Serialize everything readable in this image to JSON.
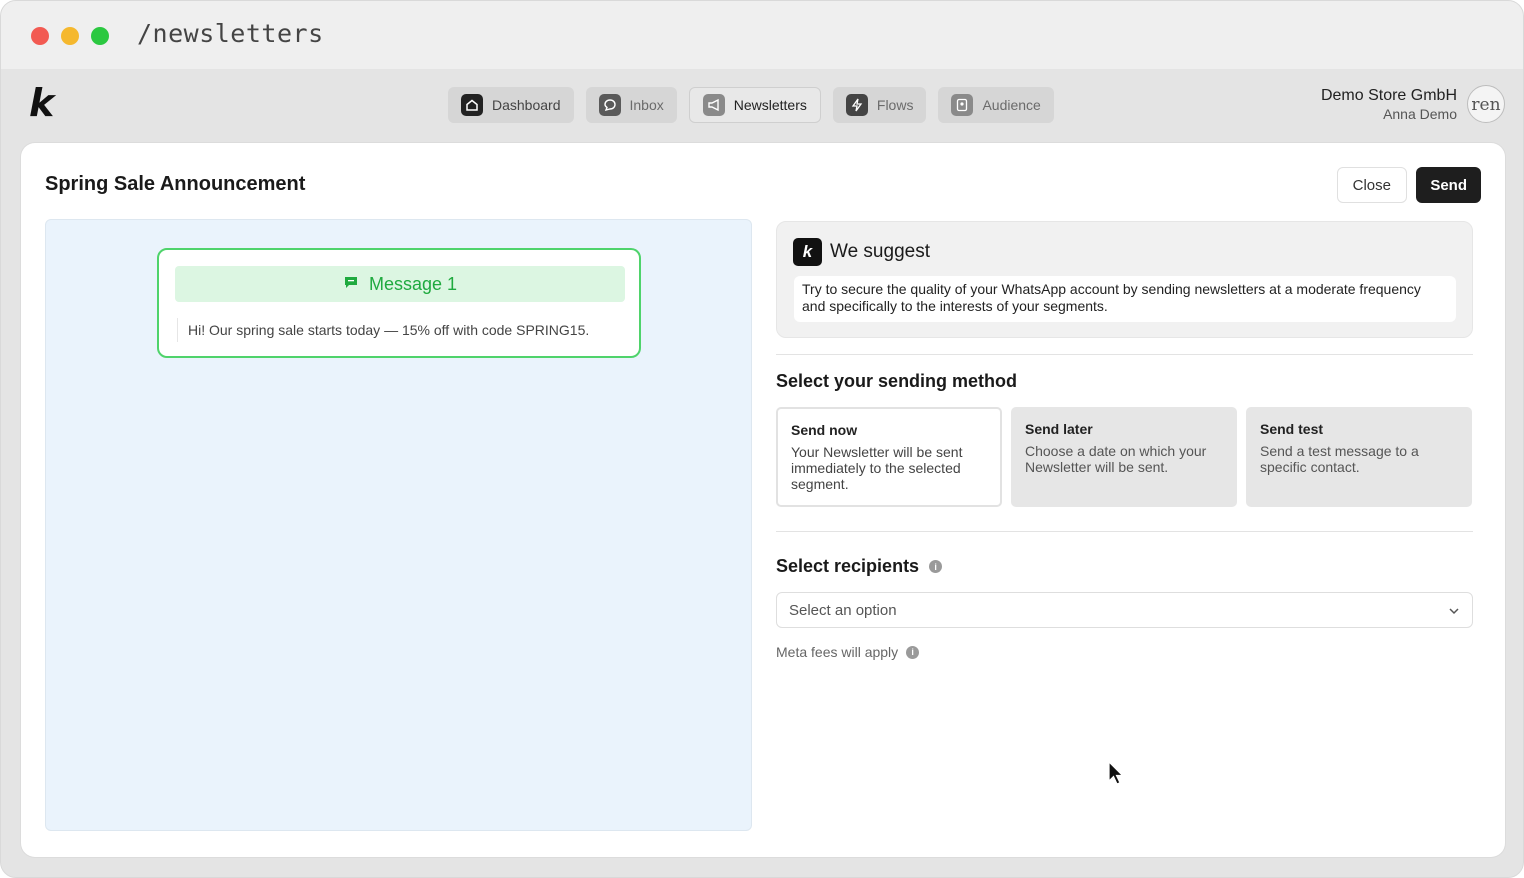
{
  "window": {
    "url": "/newsletters"
  },
  "app": {
    "logo": "k",
    "nav": [
      {
        "label": "Dashboard",
        "icon": "home-icon"
      },
      {
        "label": "Inbox",
        "icon": "chat-icon"
      },
      {
        "label": "Newsletters",
        "icon": "megaphone-icon",
        "active": true
      },
      {
        "label": "Flows",
        "icon": "lightning-icon"
      },
      {
        "label": "Audience",
        "icon": "contacts-icon"
      }
    ],
    "account": {
      "store": "Demo Store GmbH",
      "user": "Anna Demo",
      "avatar_text": "ren"
    }
  },
  "page": {
    "title": "Spring Sale Announcement",
    "close_label": "Close",
    "send_label": "Send"
  },
  "preview": {
    "message_title": "Message 1",
    "message_text": "Hi! Our spring sale starts today — 15% off with code SPRING15."
  },
  "suggest": {
    "title": "We suggest",
    "body": "Try to secure the quality of your WhatsApp account by sending newsletters at a moderate frequency and specifically to the interests of your segments."
  },
  "sending": {
    "title": "Select your sending method",
    "methods": [
      {
        "title": "Send now",
        "desc": "Your Newsletter will be sent immediately to the selected segment.",
        "selected": true
      },
      {
        "title": "Send later",
        "desc": "Choose a date on which your Newsletter will be sent."
      },
      {
        "title": "Send test",
        "desc": "Send a test message to a specific contact."
      }
    ]
  },
  "recipients": {
    "title": "Select recipients",
    "placeholder": "Select an option",
    "fees_note": "Meta fees will apply"
  },
  "colors": {
    "accent_green": "#1faa3f",
    "primary_dark": "#1e1e1e",
    "preview_bg": "#eaf3fc"
  }
}
